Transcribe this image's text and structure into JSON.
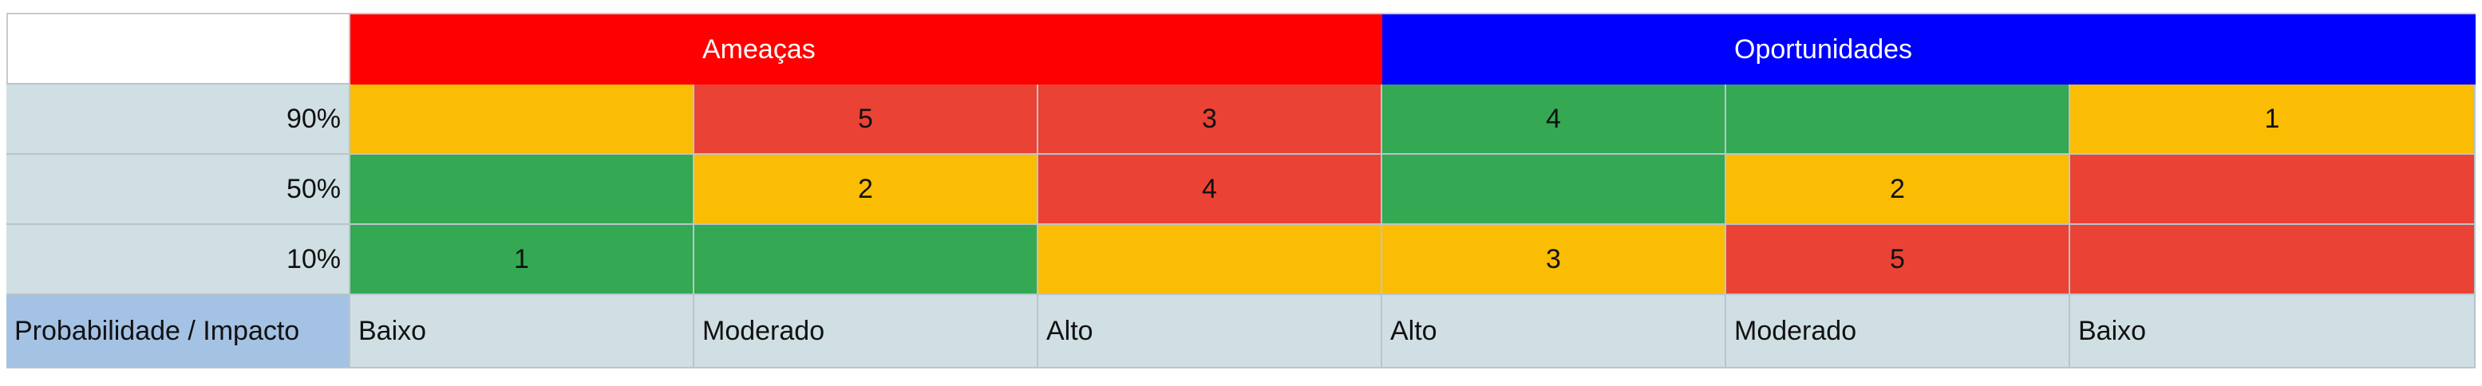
{
  "colors": {
    "threat_header": "#ff0000",
    "opportunity_header": "#0000ff",
    "yellow": "#fbbc04",
    "red": "#ea4335",
    "green": "#34a853",
    "row_label_bg": "#d0dfe3",
    "corner_label_bg": "#a4c2e4"
  },
  "header": {
    "threats": "Ameaças",
    "opportunities": "Oportunidades"
  },
  "rows": [
    {
      "label": "90%",
      "cells": [
        {
          "value": "",
          "color": "yellow"
        },
        {
          "value": "5",
          "color": "red"
        },
        {
          "value": "3",
          "color": "red"
        },
        {
          "value": "4",
          "color": "green"
        },
        {
          "value": "",
          "color": "green"
        },
        {
          "value": "1",
          "color": "yellow"
        }
      ]
    },
    {
      "label": "50%",
      "cells": [
        {
          "value": "",
          "color": "green"
        },
        {
          "value": "2",
          "color": "yellow"
        },
        {
          "value": "4",
          "color": "red"
        },
        {
          "value": "",
          "color": "green"
        },
        {
          "value": "2",
          "color": "yellow"
        },
        {
          "value": "",
          "color": "red"
        }
      ]
    },
    {
      "label": "10%",
      "cells": [
        {
          "value": "1",
          "color": "green"
        },
        {
          "value": "",
          "color": "green"
        },
        {
          "value": "",
          "color": "yellow"
        },
        {
          "value": "3",
          "color": "yellow"
        },
        {
          "value": "5",
          "color": "red"
        },
        {
          "value": "",
          "color": "red"
        }
      ]
    }
  ],
  "footer": {
    "corner_label": "Probabilidade / Impacto",
    "impacts": [
      "Baixo",
      "Moderado",
      "Alto",
      "Alto",
      "Moderado",
      "Baixo"
    ]
  }
}
